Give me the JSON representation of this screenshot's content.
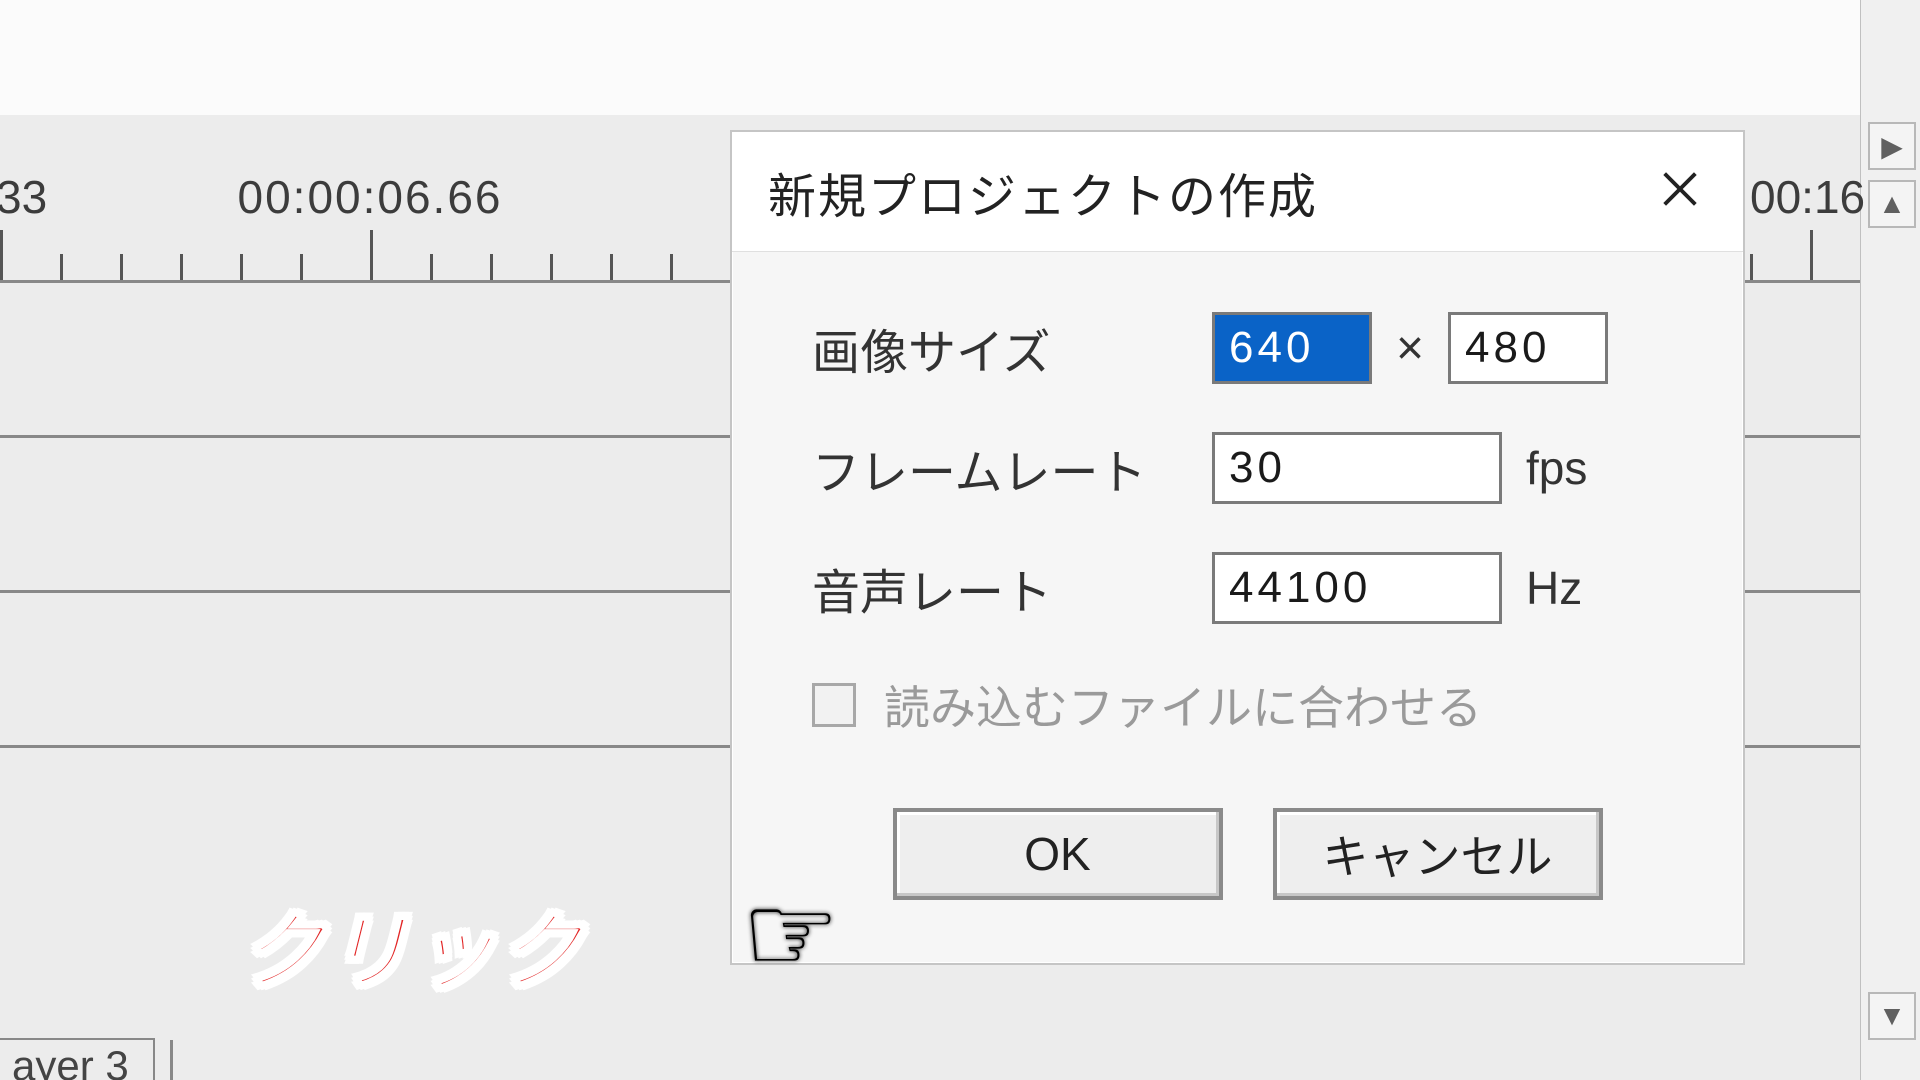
{
  "timeline": {
    "partial_left": "33",
    "time_labels": [
      "00:00:06.66"
    ],
    "partial_right_time": "00:16",
    "layer_tab": "ayer 3"
  },
  "dialog": {
    "title": "新規プロジェクトの作成",
    "labels": {
      "image_size": "画像サイズ",
      "frame_rate": "フレームレート",
      "audio_rate": "音声レート",
      "match_file": "読み込むファイルに合わせる"
    },
    "values": {
      "width": "640",
      "height": "480",
      "fps": "30",
      "hz": "44100"
    },
    "symbols": {
      "multiply": "×",
      "fps_unit": "fps",
      "hz_unit": "Hz"
    },
    "buttons": {
      "ok": "OK",
      "cancel": "キャンセル"
    }
  },
  "annotation": {
    "text": "クリック"
  },
  "sidebar": {
    "right_arrow": "▶",
    "up_arrow": "▲",
    "down_arrow": "▼"
  }
}
